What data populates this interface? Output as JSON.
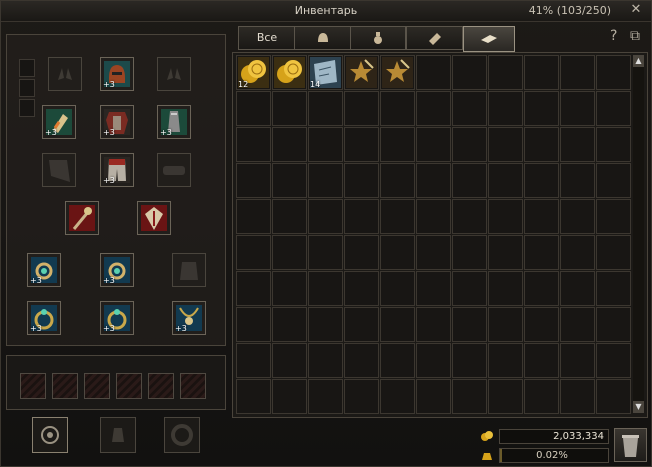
{
  "window": {
    "title": "Инвентарь",
    "capacity": "41% (103/250)",
    "close_glyph": "✕"
  },
  "tabs": [
    {
      "label": "Все",
      "icon": null,
      "active": false
    },
    {
      "label": "",
      "icon": "helmet-icon",
      "active": false
    },
    {
      "label": "",
      "icon": "potion-icon",
      "active": false
    },
    {
      "label": "",
      "icon": "material-icon",
      "active": false
    },
    {
      "label": "",
      "icon": "quest-item-icon",
      "active": true
    }
  ],
  "header_icons": {
    "help": "?",
    "expand": "⧉"
  },
  "inventory_items": [
    {
      "name": "gold-coin-item",
      "count": "12",
      "color": "#d6a21a"
    },
    {
      "name": "gold-coin-item",
      "count": "",
      "color": "#d6a21a"
    },
    {
      "name": "scroll-map-item",
      "count": "14",
      "color": "#9fb7c6"
    },
    {
      "name": "star-badge-item",
      "count": "",
      "color": "#b88a35"
    },
    {
      "name": "star-badge-item",
      "count": "",
      "color": "#b88a35"
    }
  ],
  "equipment": {
    "enchant_label": "+3"
  },
  "wallet": {
    "adena": "2,033,334",
    "weight": "0.02%",
    "weight_fraction": 0.0002
  }
}
